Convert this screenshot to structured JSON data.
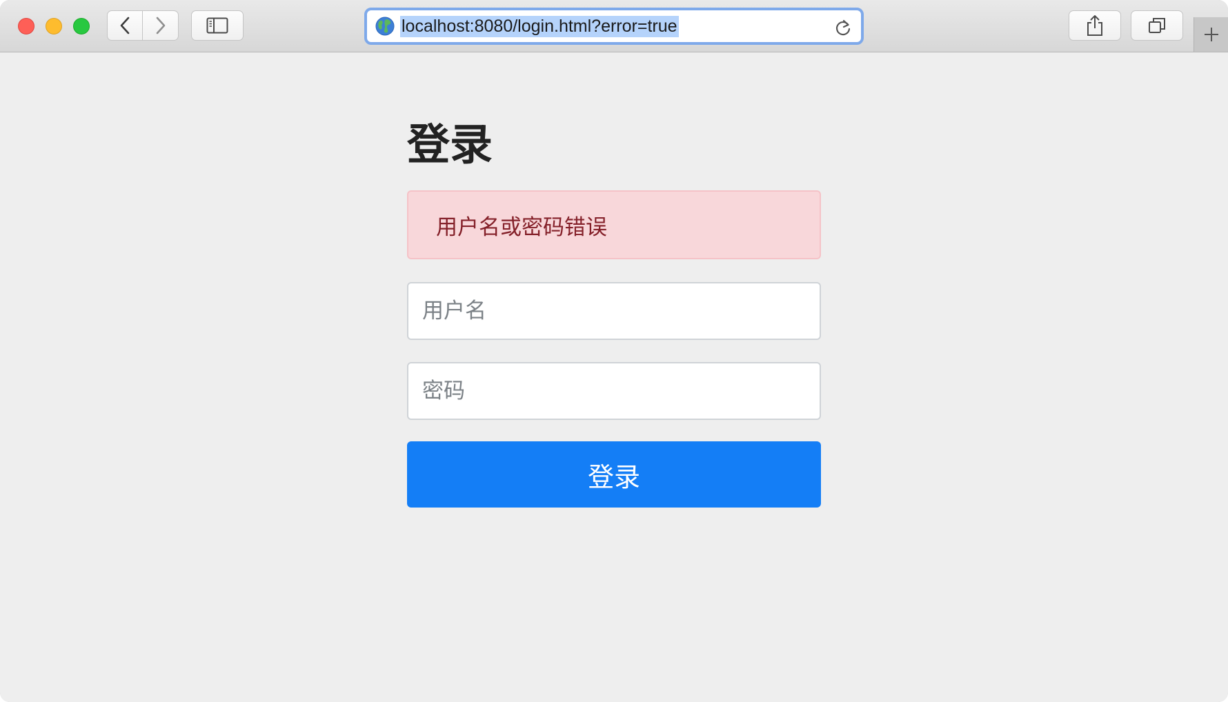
{
  "browser": {
    "url": "localhost:8080/login.html?error=true",
    "icons": {
      "back": "chevron-left-icon",
      "forward": "chevron-right-icon",
      "sidebar": "sidebar-icon",
      "globe": "globe-icon",
      "reload": "reload-icon",
      "share": "share-icon",
      "tabs": "tabs-overview-icon",
      "new_tab": "plus-icon"
    },
    "colors": {
      "close": "#fe5f57",
      "minimize": "#febc2e",
      "zoom": "#28c840",
      "address_focus": "#7ea9ea",
      "selection": "#b5d3fb"
    }
  },
  "login": {
    "title": "登录",
    "error_message": "用户名或密码错误",
    "username_placeholder": "用户名",
    "password_placeholder": "密码",
    "submit_label": "登录",
    "colors": {
      "alert_bg": "#f8d7da",
      "alert_text": "#842029",
      "button_bg": "#147ef6",
      "button_text": "#ffffff"
    }
  }
}
